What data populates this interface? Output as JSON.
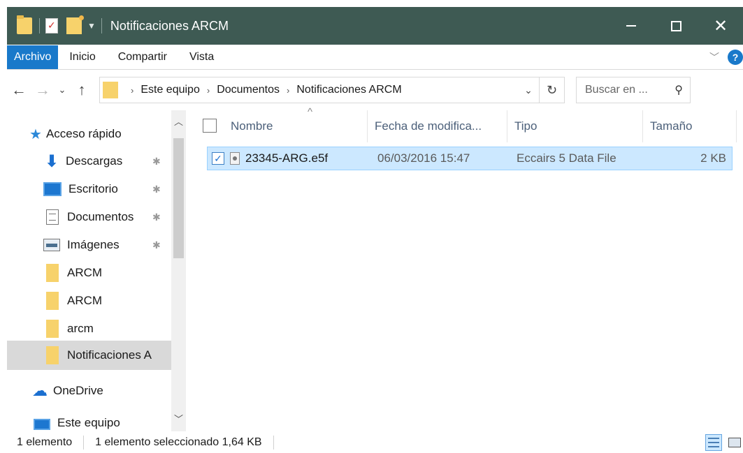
{
  "window": {
    "title": "Notificaciones ARCM",
    "minimize_label": "—",
    "close_label": "✕"
  },
  "ribbon": {
    "tabs": [
      "Archivo",
      "Inicio",
      "Compartir",
      "Vista"
    ],
    "active_tab": "Archivo",
    "help_label": "?"
  },
  "address": {
    "breadcrumbs": [
      "Este equipo",
      "Documentos",
      "Notificaciones ARCM"
    ],
    "search_placeholder": "Buscar en ..."
  },
  "nav_pane": {
    "items": [
      {
        "label": "Acceso rápido",
        "icon": "star-icon",
        "pinned": false
      },
      {
        "label": "Descargas",
        "icon": "download-icon",
        "pinned": true
      },
      {
        "label": "Escritorio",
        "icon": "desktop-icon",
        "pinned": true
      },
      {
        "label": "Documentos",
        "icon": "documents-icon",
        "pinned": true
      },
      {
        "label": "Imágenes",
        "icon": "pictures-icon",
        "pinned": true
      },
      {
        "label": "ARCM",
        "icon": "folder-icon",
        "pinned": false
      },
      {
        "label": "ARCM",
        "icon": "folder-icon",
        "pinned": false
      },
      {
        "label": "arcm",
        "icon": "folder-icon",
        "pinned": false
      },
      {
        "label": "Notificaciones A",
        "icon": "folder-icon",
        "pinned": false,
        "selected": true
      },
      {
        "label": "OneDrive",
        "icon": "onedrive-icon",
        "pinned": false
      },
      {
        "label": "Este equipo",
        "icon": "computer-icon",
        "pinned": false
      }
    ]
  },
  "file_list": {
    "columns": [
      "Nombre",
      "Fecha de modifica...",
      "Tipo",
      "Tamaño"
    ],
    "rows": [
      {
        "name": "23345-ARG.e5f",
        "modified": "06/03/2016 15:47",
        "type": "Eccairs 5 Data File",
        "size": "2 KB",
        "selected": true
      }
    ]
  },
  "status_bar": {
    "item_count": "1 elemento",
    "selection": "1 elemento seleccionado  1,64 KB"
  },
  "colors": {
    "titlebar": "#3e5a53",
    "accent": "#1979ca",
    "selection": "#cce8ff"
  }
}
